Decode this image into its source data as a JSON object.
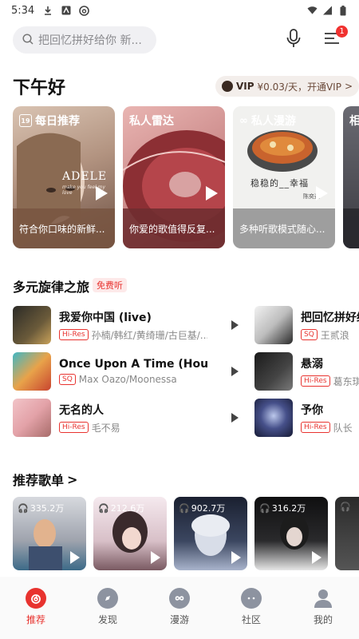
{
  "status_bar": {
    "time": "5:34"
  },
  "search": {
    "placeholder": "把回忆拼好给你 新..."
  },
  "menu": {
    "badge": "1"
  },
  "greeting": "下午好",
  "vip": {
    "logo_text": "VIP",
    "price": "¥0.03/天，开通VIP",
    "arrow": ">"
  },
  "recommend_cards": [
    {
      "label": "每日推荐",
      "date": "19",
      "caption": "符合你口味的新鲜...",
      "cover_text": "ADELE",
      "cover_sub": "make you feel my love"
    },
    {
      "label": "私人雷达",
      "caption": "你爱的歌值得反复..."
    },
    {
      "label": "私人漫游",
      "caption": "多种听歌模式随心...",
      "cover_text": "稳稳的__幸福",
      "cover_sub": "陈奕迅"
    },
    {
      "label": "相"
    }
  ],
  "section_diverse": {
    "title": "多元旋律之旅",
    "badge": "免费听"
  },
  "songs": [
    {
      "title": "我爱你中国 (live)",
      "tag": "Hi-Res",
      "artist": "孙楠/韩红/黄绮珊/古巨基/..."
    },
    {
      "title": "Once Upon A Time (House...",
      "tag": "SQ",
      "artist": "Max Oazo/Moonessa"
    },
    {
      "title": "无名的人",
      "tag": "Hi-Res",
      "artist": "毛不易"
    },
    {
      "title": "把回忆拼好给你",
      "tag": "SQ",
      "artist": "王贰浪"
    },
    {
      "title": "悬溺",
      "tag": "Hi-Res",
      "artist": "葛东琪"
    },
    {
      "title": "予你",
      "tag": "Hi-Res",
      "artist": "队长"
    }
  ],
  "section_playlists": {
    "title": "推荐歌单",
    "arrow": ">"
  },
  "playlists": [
    {
      "count": "335.2万"
    },
    {
      "count": "212.6万"
    },
    {
      "count": "902.7万"
    },
    {
      "count": "316.2万"
    },
    {
      "count": ""
    }
  ],
  "tabs": [
    {
      "label": "推荐",
      "active": true
    },
    {
      "label": "发现"
    },
    {
      "label": "漫游"
    },
    {
      "label": "社区"
    },
    {
      "label": "我的"
    }
  ],
  "colors": {
    "accent": "#e8332f",
    "tab_inactive": "#8d93a0",
    "search_bg": "#f0f0f3"
  }
}
